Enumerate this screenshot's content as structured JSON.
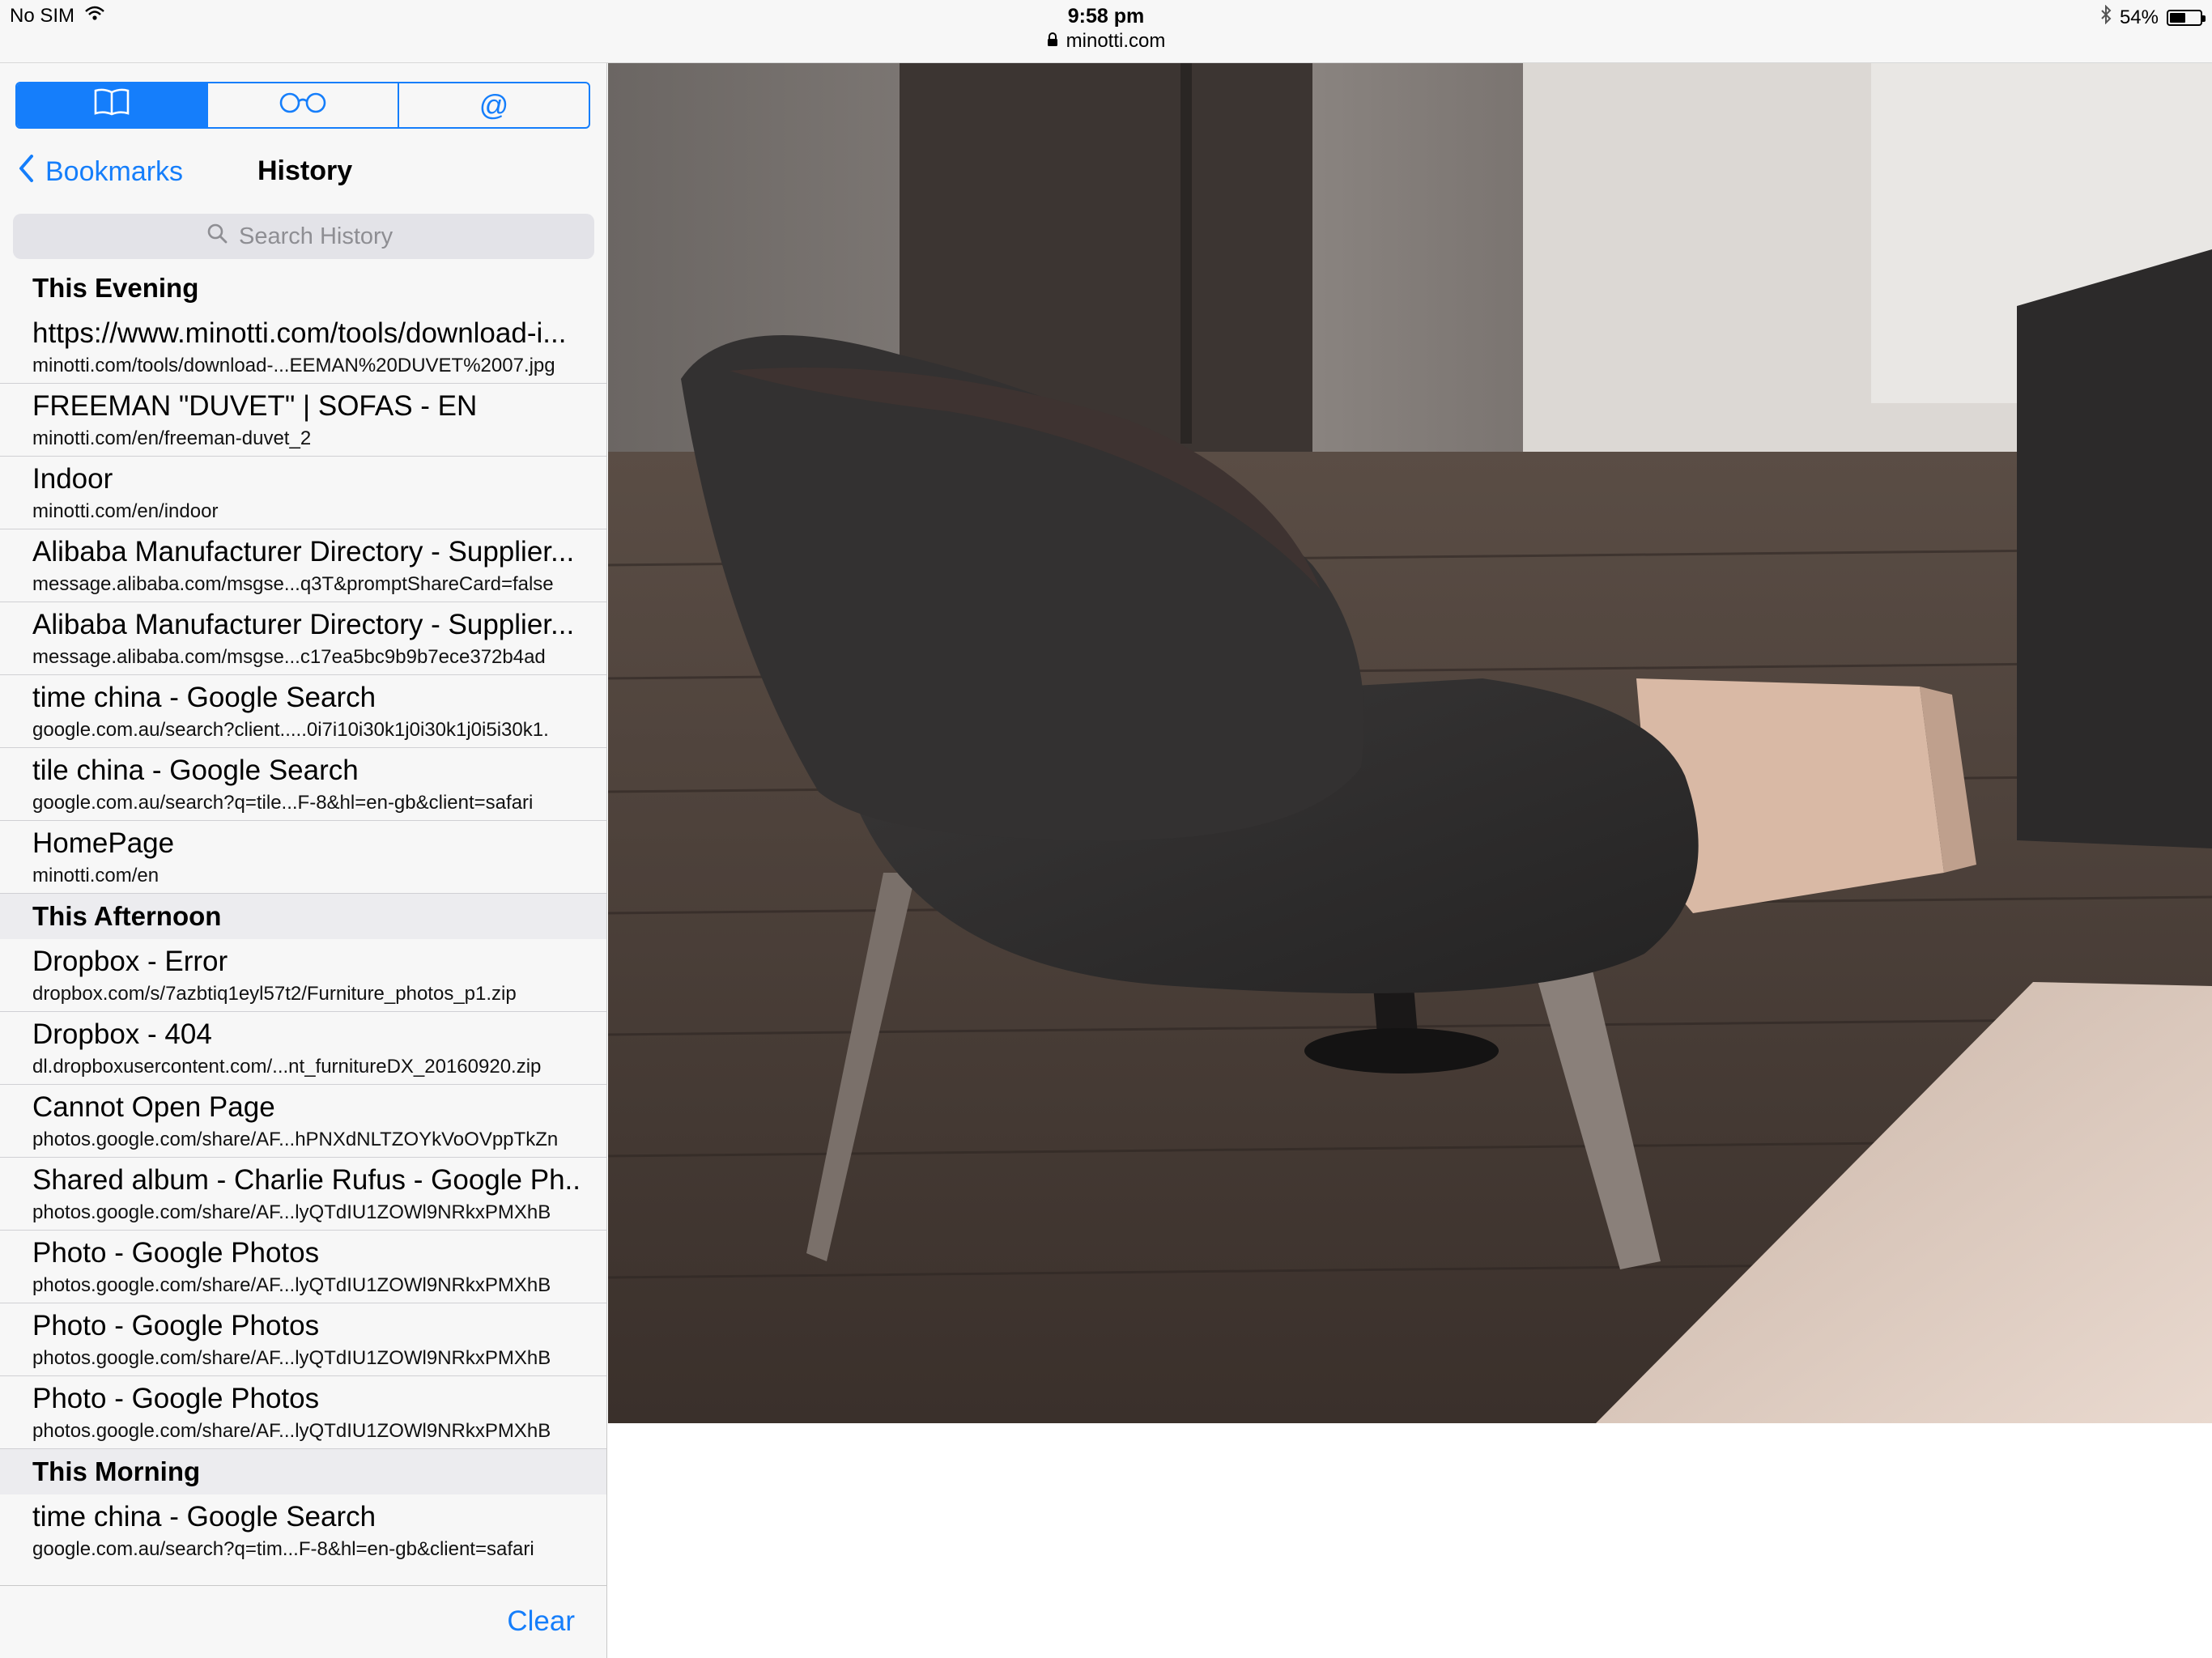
{
  "status_bar": {
    "carrier": "No SIM",
    "time": "9:58 pm",
    "url": "minotti.com",
    "battery": "54%",
    "battery_level": 0.54,
    "icons": [
      "wifi-icon",
      "lock-icon",
      "bluetooth-icon",
      "battery-icon"
    ]
  },
  "sidebar": {
    "tabs": [
      {
        "name": "bookmarks",
        "icon": "book-icon",
        "active": true
      },
      {
        "name": "reading-list",
        "icon": "glasses-icon",
        "active": false
      },
      {
        "name": "shared-links",
        "icon": "at-sign-icon",
        "active": false,
        "glyph": "@"
      }
    ],
    "back_label": "Bookmarks",
    "title": "History",
    "search_placeholder": "Search History",
    "sections": [
      {
        "header": "This Evening",
        "items": [
          {
            "title": "https://www.minotti.com/tools/download-i...",
            "url": "minotti.com/tools/download-...EEMAN%20DUVET%2007.jpg"
          },
          {
            "title": "FREEMAN \"DUVET\" | SOFAS - EN",
            "url": "minotti.com/en/freeman-duvet_2"
          },
          {
            "title": "Indoor",
            "url": "minotti.com/en/indoor"
          },
          {
            "title": "Alibaba Manufacturer Directory - Supplier...",
            "url": "message.alibaba.com/msgse...q3T&promptShareCard=false"
          },
          {
            "title": "Alibaba Manufacturer Directory - Supplier...",
            "url": "message.alibaba.com/msgse...c17ea5bc9b9b7ece372b4ad"
          },
          {
            "title": "time china - Google Search",
            "url": "google.com.au/search?client.....0i7i10i30k1j0i30k1j0i5i30k1."
          },
          {
            "title": "tile china - Google Search",
            "url": "google.com.au/search?q=tile...F-8&hl=en-gb&client=safari"
          },
          {
            "title": "HomePage",
            "url": "minotti.com/en"
          }
        ]
      },
      {
        "header": "This Afternoon",
        "items": [
          {
            "title": "Dropbox - Error",
            "url": "dropbox.com/s/7azbtiq1eyl57t2/Furniture_photos_p1.zip"
          },
          {
            "title": "Dropbox - 404",
            "url": "dl.dropboxusercontent.com/...nt_furnitureDX_20160920.zip"
          },
          {
            "title": "Cannot Open Page",
            "url": "photos.google.com/share/AF...hPNXdNLTZOYkVoOVppTkZn"
          },
          {
            "title": "Shared album - Charlie Rufus - Google Ph...",
            "url": "photos.google.com/share/AF...lyQTdIU1ZOWl9NRkxPMXhB"
          },
          {
            "title": "Photo - Google Photos",
            "url": "photos.google.com/share/AF...lyQTdIU1ZOWl9NRkxPMXhB"
          },
          {
            "title": "Photo - Google Photos",
            "url": "photos.google.com/share/AF...lyQTdIU1ZOWl9NRkxPMXhB"
          },
          {
            "title": "Photo - Google Photos",
            "url": "photos.google.com/share/AF...lyQTdIU1ZOWl9NRkxPMXhB"
          }
        ]
      },
      {
        "header": "This Morning",
        "items": [
          {
            "title": "time china - Google Search",
            "url": "google.com.au/search?q=tim...F-8&hl=en-gb&client=safari"
          }
        ]
      }
    ],
    "clear_label": "Clear"
  },
  "content": {
    "image_subject": "armchair-photo",
    "colors": {
      "accent": "#157efb"
    }
  }
}
